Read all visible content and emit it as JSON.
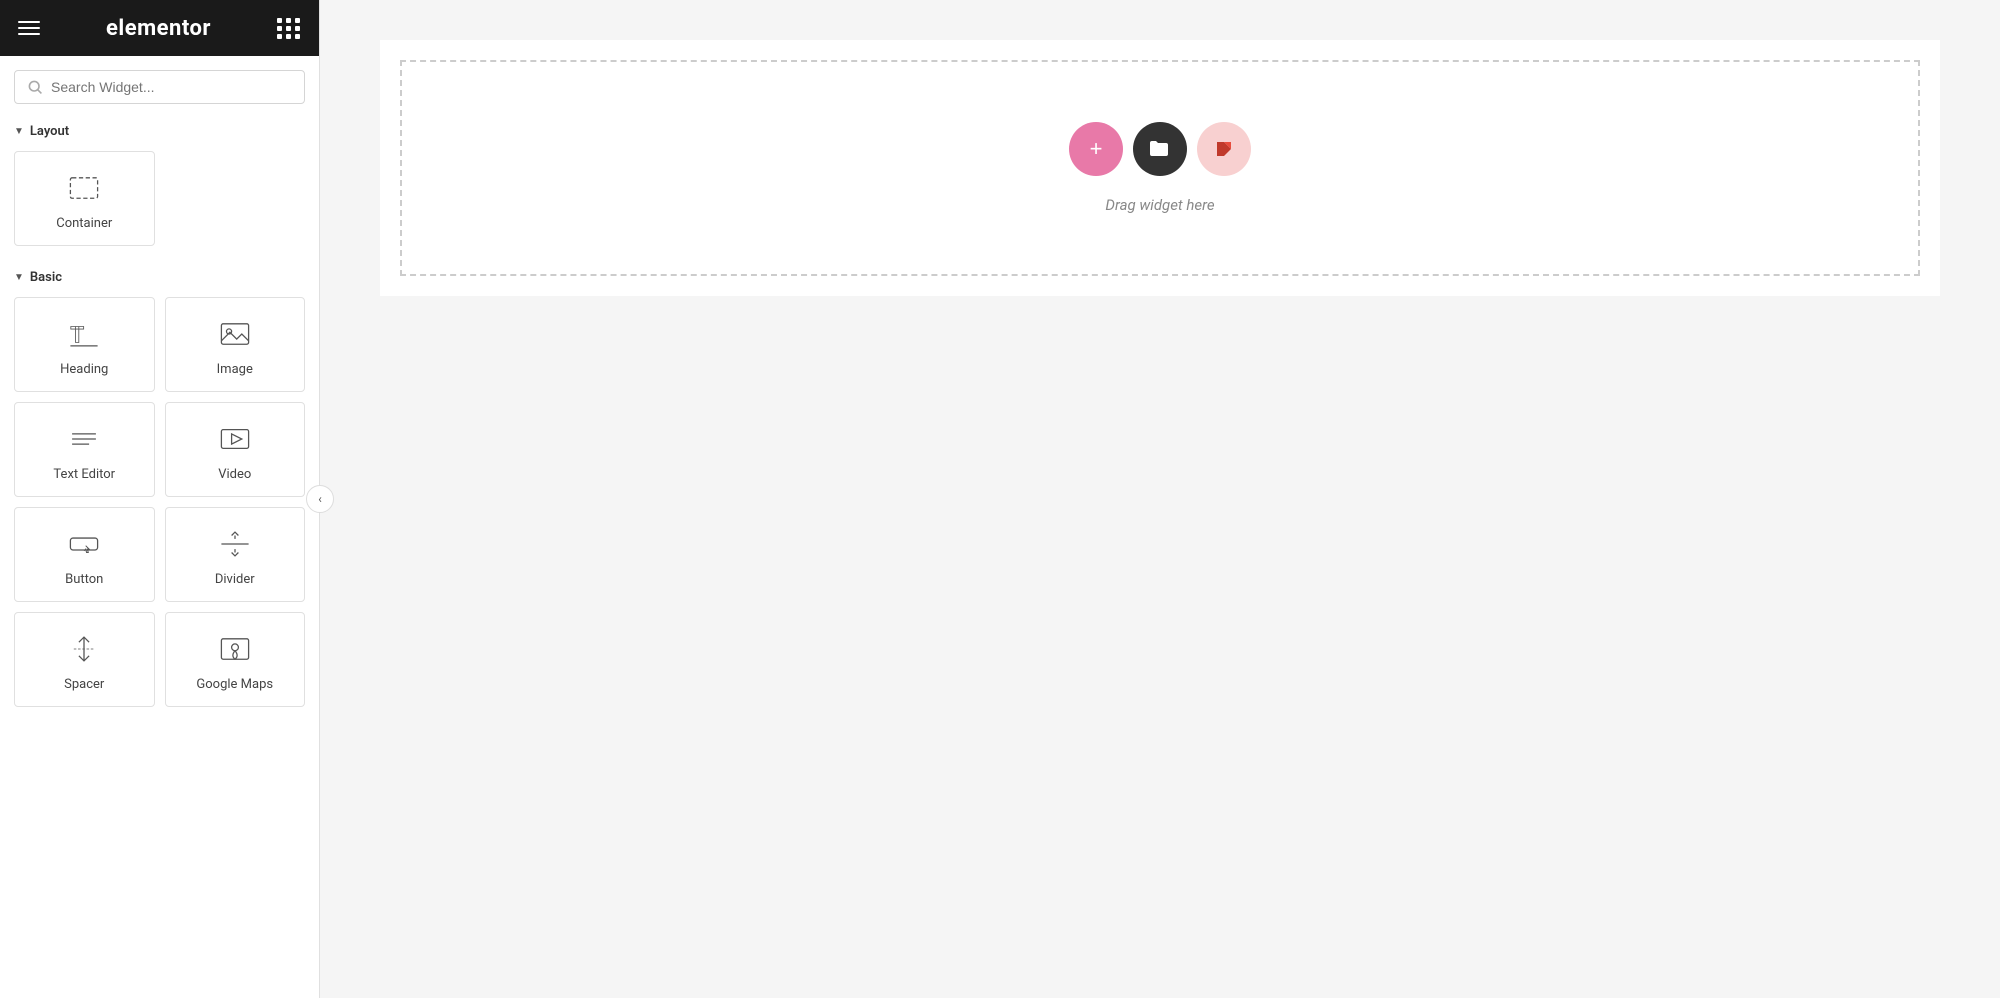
{
  "header": {
    "logo": "elementor",
    "hamburger_label": "menu",
    "apps_label": "apps"
  },
  "search": {
    "placeholder": "Search Widget..."
  },
  "sections": {
    "layout": {
      "label": "Layout",
      "widgets": [
        {
          "id": "container",
          "label": "Container",
          "icon": "container-icon"
        }
      ]
    },
    "basic": {
      "label": "Basic",
      "widgets": [
        {
          "id": "heading",
          "label": "Heading",
          "icon": "heading-icon"
        },
        {
          "id": "image",
          "label": "Image",
          "icon": "image-icon"
        },
        {
          "id": "text-editor",
          "label": "Text Editor",
          "icon": "text-editor-icon"
        },
        {
          "id": "video",
          "label": "Video",
          "icon": "video-icon"
        },
        {
          "id": "button",
          "label": "Button",
          "icon": "button-icon"
        },
        {
          "id": "divider",
          "label": "Divider",
          "icon": "divider-icon"
        },
        {
          "id": "spacer",
          "label": "Spacer",
          "icon": "spacer-icon"
        },
        {
          "id": "google-maps",
          "label": "Google Maps",
          "icon": "google-maps-icon"
        }
      ]
    }
  },
  "canvas": {
    "drag_hint": "Drag widget here"
  },
  "colors": {
    "accent_pink": "#e879a8",
    "dark": "#1a1a1a",
    "folder_btn": "#333333",
    "news_bg": "#f8d0d0",
    "news_color": "#c0392b"
  }
}
